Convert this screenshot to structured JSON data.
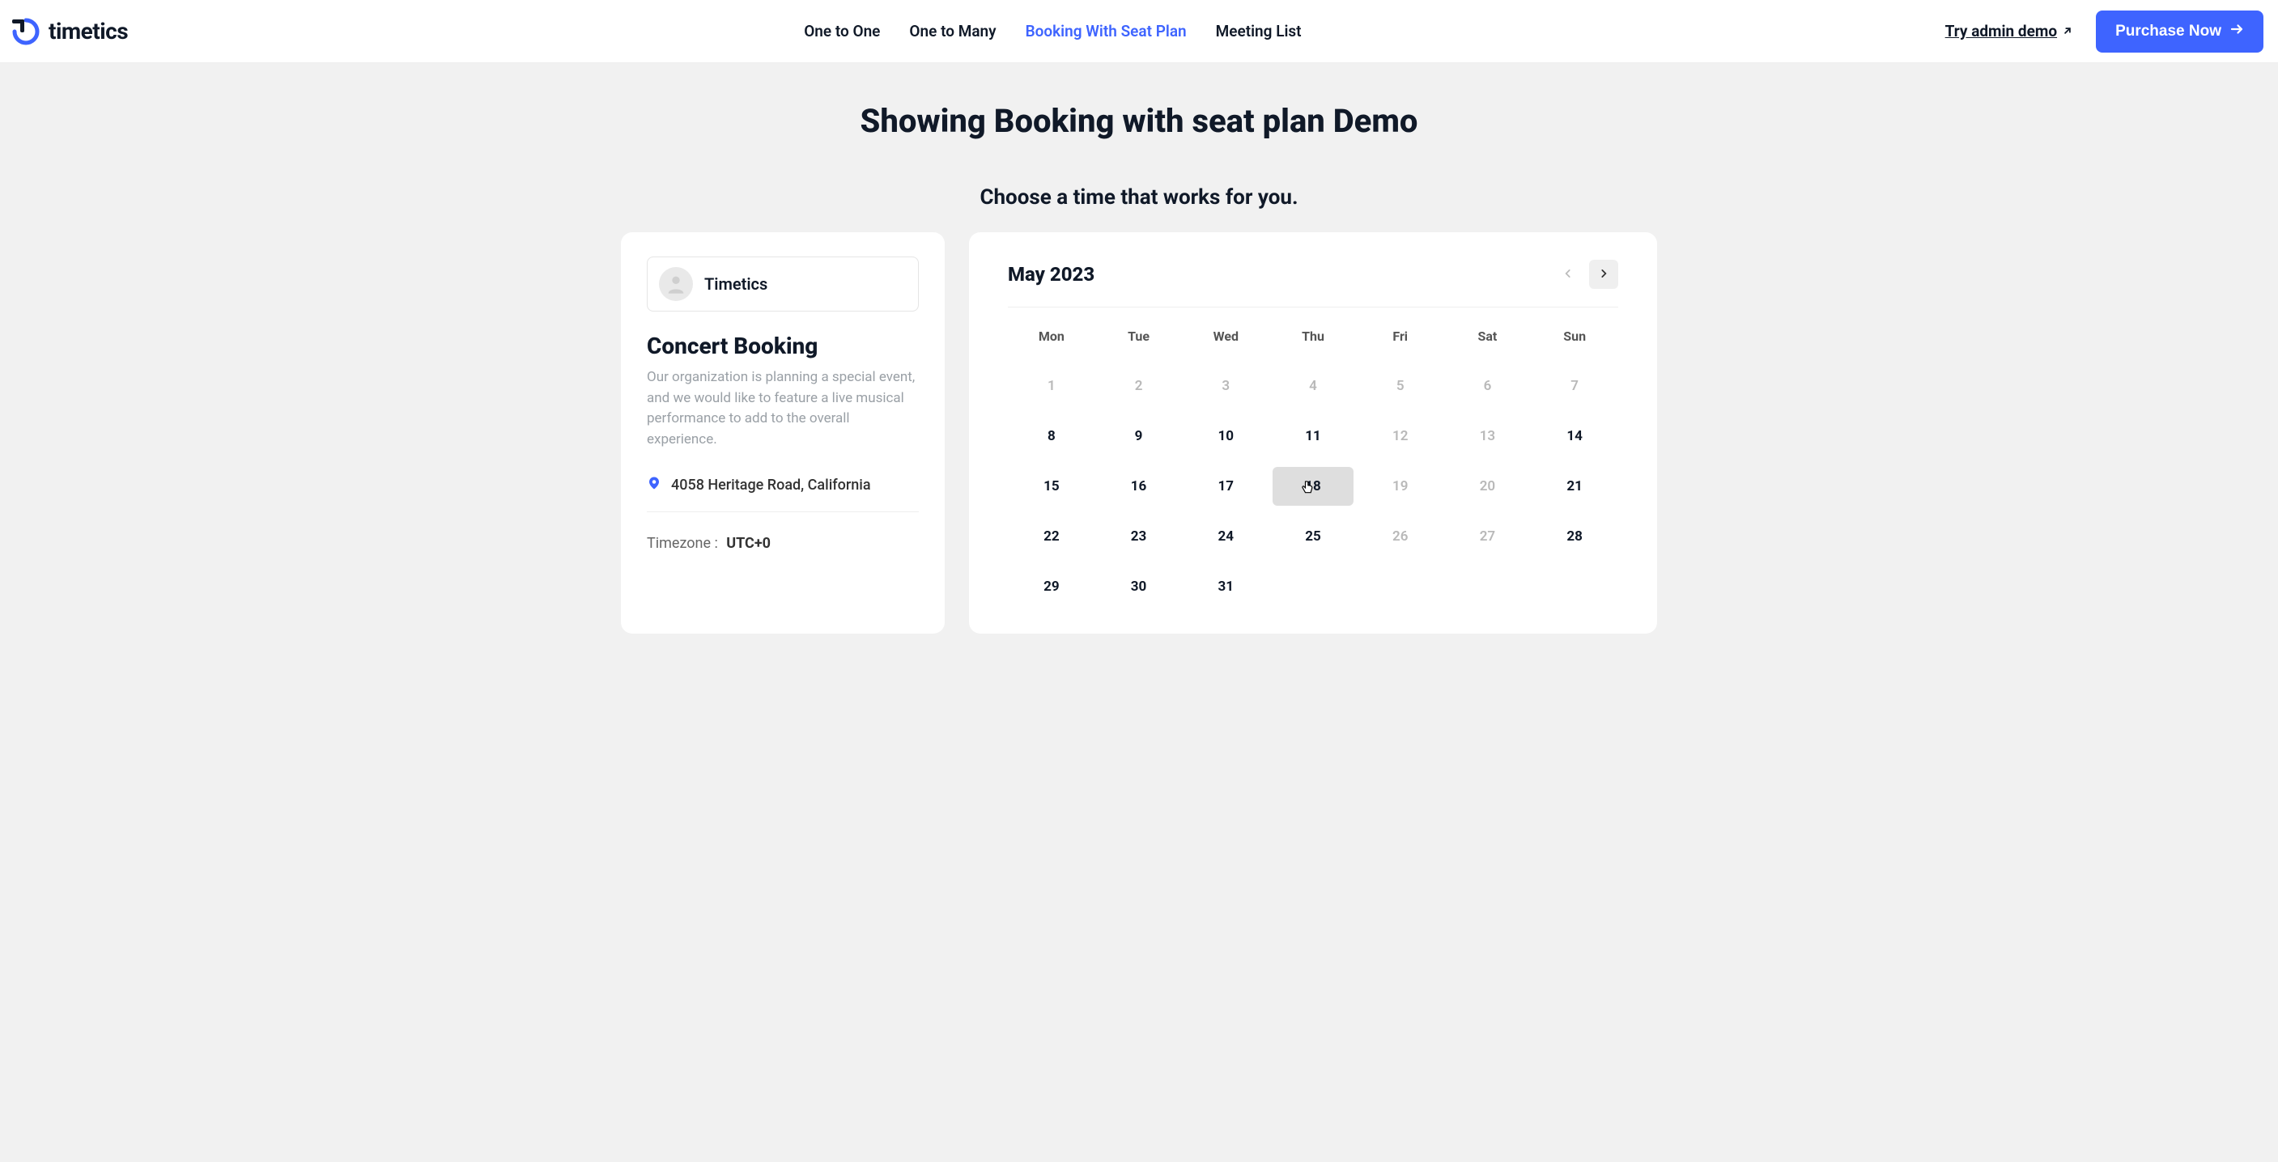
{
  "header": {
    "brand": "timetics",
    "nav": [
      {
        "label": "One to One",
        "active": false
      },
      {
        "label": "One to Many",
        "active": false
      },
      {
        "label": "Booking With Seat Plan",
        "active": true
      },
      {
        "label": "Meeting List",
        "active": false
      }
    ],
    "admin_demo": "Try admin demo",
    "purchase": "Purchase Now"
  },
  "main": {
    "title": "Showing Booking with seat plan Demo",
    "subtitle": "Choose a time that works for you."
  },
  "event": {
    "organizer": "Timetics",
    "title": "Concert Booking",
    "description": "Our organization is planning a special event, and we would like to feature a live musical performance to add to the overall experience.",
    "location": "4058 Heritage Road, California",
    "timezone_label": "Timezone :",
    "timezone_value": "UTC+0"
  },
  "calendar": {
    "month_label": "May 2023",
    "dow": [
      "Mon",
      "Tue",
      "Wed",
      "Thu",
      "Fri",
      "Sat",
      "Sun"
    ],
    "weeks": [
      [
        {
          "n": "1",
          "dim": true
        },
        {
          "n": "2",
          "dim": true
        },
        {
          "n": "3",
          "dim": true
        },
        {
          "n": "4",
          "dim": true
        },
        {
          "n": "5",
          "dim": true
        },
        {
          "n": "6",
          "dim": true
        },
        {
          "n": "7",
          "dim": true
        }
      ],
      [
        {
          "n": "8"
        },
        {
          "n": "9"
        },
        {
          "n": "10"
        },
        {
          "n": "11"
        },
        {
          "n": "12",
          "dim": true
        },
        {
          "n": "13",
          "dim": true
        },
        {
          "n": "14"
        }
      ],
      [
        {
          "n": "15"
        },
        {
          "n": "16"
        },
        {
          "n": "17"
        },
        {
          "n": "18",
          "hover": true
        },
        {
          "n": "19",
          "dim": true
        },
        {
          "n": "20",
          "dim": true
        },
        {
          "n": "21"
        }
      ],
      [
        {
          "n": "22"
        },
        {
          "n": "23"
        },
        {
          "n": "24"
        },
        {
          "n": "25"
        },
        {
          "n": "26",
          "dim": true
        },
        {
          "n": "27",
          "dim": true
        },
        {
          "n": "28"
        }
      ],
      [
        {
          "n": "29"
        },
        {
          "n": "30"
        },
        {
          "n": "31"
        },
        {
          "n": ""
        },
        {
          "n": ""
        },
        {
          "n": ""
        },
        {
          "n": ""
        }
      ]
    ]
  }
}
